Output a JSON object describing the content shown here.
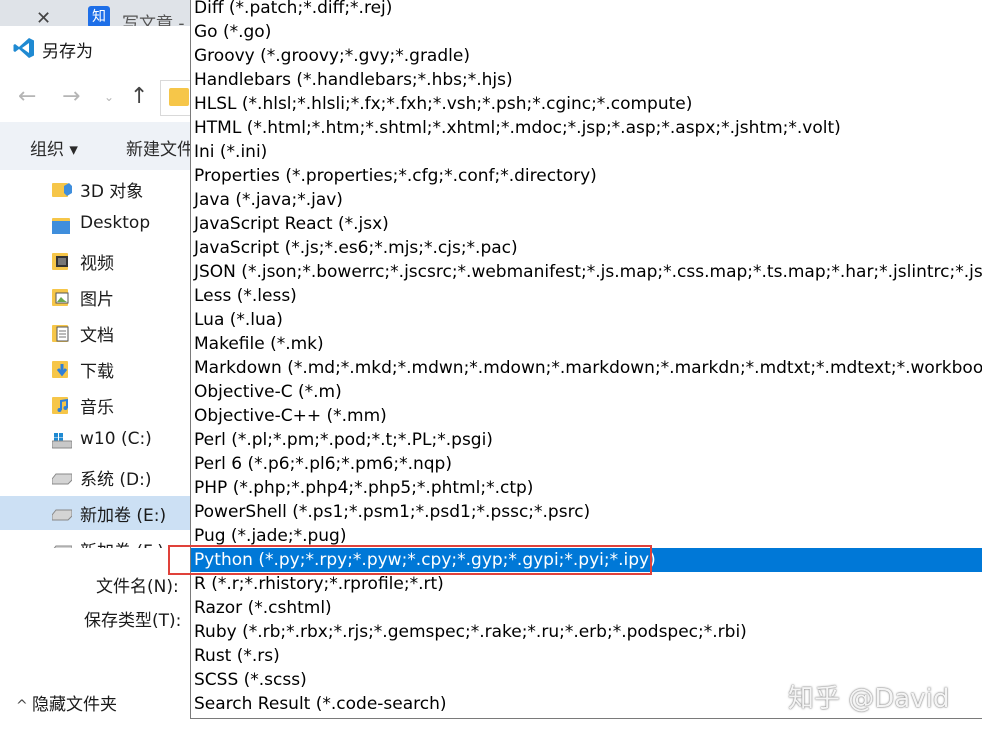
{
  "browser": {
    "tab_close": "✕",
    "tab_favicon": "知",
    "tab_title": "写文章 -"
  },
  "dialog": {
    "title": "另存为",
    "nav": {
      "back": "←",
      "forward": "→",
      "dropdown": "⌄",
      "up": "↑"
    },
    "toolbar": {
      "organize": "组织 ▾",
      "new_folder": "新建文件夹"
    },
    "sidebar": {
      "items": [
        {
          "label": "3D 对象",
          "icon": "3d-objects-icon"
        },
        {
          "label": "Desktop",
          "icon": "folder-icon"
        },
        {
          "label": "视频",
          "icon": "video-icon"
        },
        {
          "label": "图片",
          "icon": "pictures-icon"
        },
        {
          "label": "文档",
          "icon": "documents-icon"
        },
        {
          "label": "下载",
          "icon": "downloads-icon"
        },
        {
          "label": "音乐",
          "icon": "music-icon"
        },
        {
          "label": "w10 (C:)",
          "icon": "drive-icon"
        },
        {
          "label": "系统 (D:)",
          "icon": "drive-icon"
        },
        {
          "label": "新加卷 (E:)",
          "icon": "drive-icon",
          "selected": true
        },
        {
          "label": "新加卷 (F:)",
          "icon": "drive-icon"
        }
      ]
    },
    "filename_label": "文件名(N):",
    "filetype_label": "保存类型(T):",
    "hide_folders_icon": "^",
    "hide_folders": "隐藏文件夹"
  },
  "file_types": [
    "Diff (*.patch;*.diff;*.rej)",
    "Go (*.go)",
    "Groovy (*.groovy;*.gvy;*.gradle)",
    "Handlebars (*.handlebars;*.hbs;*.hjs)",
    "HLSL (*.hlsl;*.hlsli;*.fx;*.fxh;*.vsh;*.psh;*.cginc;*.compute)",
    "HTML (*.html;*.htm;*.shtml;*.xhtml;*.mdoc;*.jsp;*.asp;*.aspx;*.jshtm;*.volt)",
    "Ini (*.ini)",
    "Properties (*.properties;*.cfg;*.conf;*.directory)",
    "Java (*.java;*.jav)",
    "JavaScript React (*.jsx)",
    "JavaScript (*.js;*.es6;*.mjs;*.cjs;*.pac)",
    "JSON (*.json;*.bowerrc;*.jscsrc;*.webmanifest;*.js.map;*.css.map;*.ts.map;*.har;*.jslintrc;*.jsonld)",
    "Less (*.less)",
    "Lua (*.lua)",
    "Makefile (*.mk)",
    "Markdown (*.md;*.mkd;*.mdwn;*.mdown;*.markdown;*.markdn;*.mdtxt;*.mdtext;*.workbook)",
    "Objective-C (*.m)",
    "Objective-C++ (*.mm)",
    "Perl (*.pl;*.pm;*.pod;*.t;*.PL;*.psgi)",
    "Perl 6 (*.p6;*.pl6;*.pm6;*.nqp)",
    "PHP (*.php;*.php4;*.php5;*.phtml;*.ctp)",
    "PowerShell (*.ps1;*.psm1;*.psd1;*.pssc;*.psrc)",
    "Pug (*.jade;*.pug)",
    "Python (*.py;*.rpy;*.pyw;*.cpy;*.gyp;*.gypi;*.pyi;*.ipy)",
    "R (*.r;*.rhistory;*.rprofile;*.rt)",
    "Razor (*.cshtml)",
    "Ruby (*.rb;*.rbx;*.rjs;*.gemspec;*.rake;*.ru;*.erb;*.podspec;*.rbi)",
    "Rust (*.rs)",
    "SCSS (*.scss)",
    "Search Result (*.code-search)"
  ],
  "selected_file_type": "Python (*.py;*.rpy;*.pyw;*.cpy;*.gyp;*.gypi;*.pyi;*.ipy)",
  "highlight_color": "#e0413a",
  "selection_color": "#0078d7",
  "watermark": "知乎 @David"
}
